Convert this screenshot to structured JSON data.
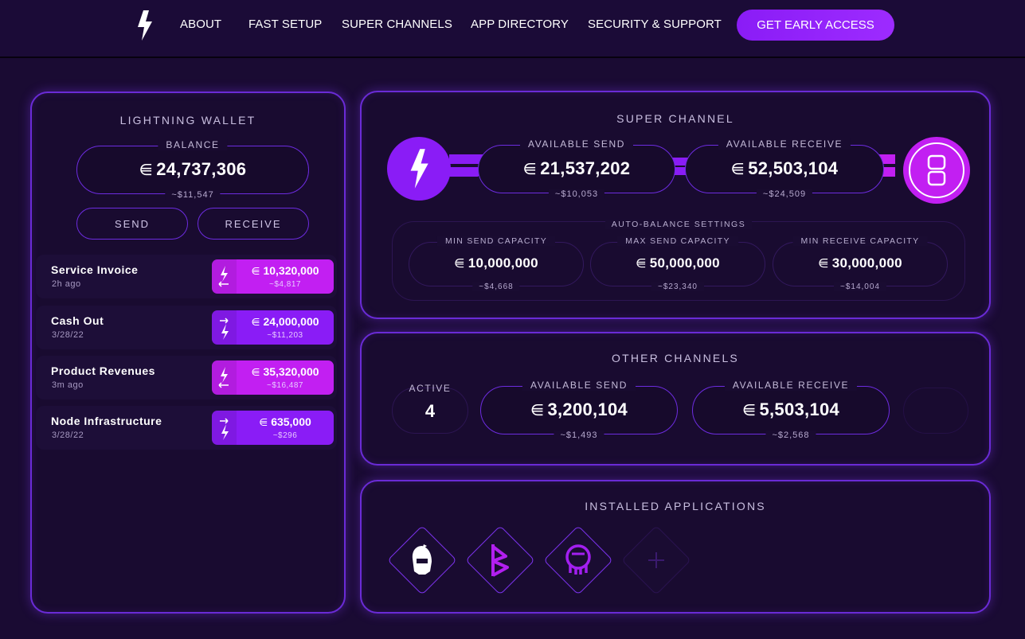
{
  "nav": {
    "links": [
      "ABOUT",
      "FAST SETUP",
      "SUPER CHANNELS",
      "APP DIRECTORY",
      "SECURITY & SUPPORT"
    ],
    "cta": "GET EARLY ACCESS"
  },
  "sat_symbol": "⋹",
  "wallet": {
    "title": "LIGHTNING WALLET",
    "balance_label": "BALANCE",
    "balance_value": "24,737,306",
    "balance_usd": "~$11,547",
    "send_label": "SEND",
    "receive_label": "RECEIVE",
    "transactions": [
      {
        "name": "Service Invoice",
        "date": "2h ago",
        "amount": "10,320,000",
        "usd": "~$4,817",
        "kind": "receive"
      },
      {
        "name": "Cash Out",
        "date": "3/28/22",
        "amount": "24,000,000",
        "usd": "~$11,203",
        "kind": "send"
      },
      {
        "name": "Product Revenues",
        "date": "3m ago",
        "amount": "35,320,000",
        "usd": "~$16,487",
        "kind": "receive"
      },
      {
        "name": "Node Infrastructure",
        "date": "3/28/22",
        "amount": "635,000",
        "usd": "~$296",
        "kind": "send"
      }
    ]
  },
  "super_channel": {
    "title": "SUPER CHANNEL",
    "send_label": "AVAILABLE SEND",
    "send_value": "21,537,202",
    "send_usd": "~$10,053",
    "receive_label": "AVAILABLE RECEIVE",
    "receive_value": "52,503,104",
    "receive_usd": "~$24,509",
    "auto_balance_title": "AUTO-BALANCE SETTINGS",
    "settings": [
      {
        "label": "MIN SEND CAPACITY",
        "value": "10,000,000",
        "usd": "~$4,668"
      },
      {
        "label": "MAX SEND CAPACITY",
        "value": "50,000,000",
        "usd": "~$23,340"
      },
      {
        "label": "MIN RECEIVE CAPACITY",
        "value": "30,000,000",
        "usd": "~$14,004"
      }
    ]
  },
  "other_channels": {
    "title": "OTHER CHANNELS",
    "active_label": "ACTIVE",
    "active_value": "4",
    "send_label": "AVAILABLE SEND",
    "send_value": "3,200,104",
    "send_usd": "~$1,493",
    "receive_label": "AVAILABLE RECEIVE",
    "receive_value": "5,503,104",
    "receive_usd": "~$2,568"
  },
  "apps": {
    "title": "INSTALLED APPLICATIONS",
    "items": [
      "knight-helmet-icon",
      "bitcoin-b-icon",
      "octopus-icon",
      "add-app-icon"
    ]
  },
  "colors": {
    "background": "#1a0b33",
    "accent_purple": "#8a1cf6",
    "accent_magenta": "#c21ff2",
    "panel_border": "#6a2bd6"
  }
}
